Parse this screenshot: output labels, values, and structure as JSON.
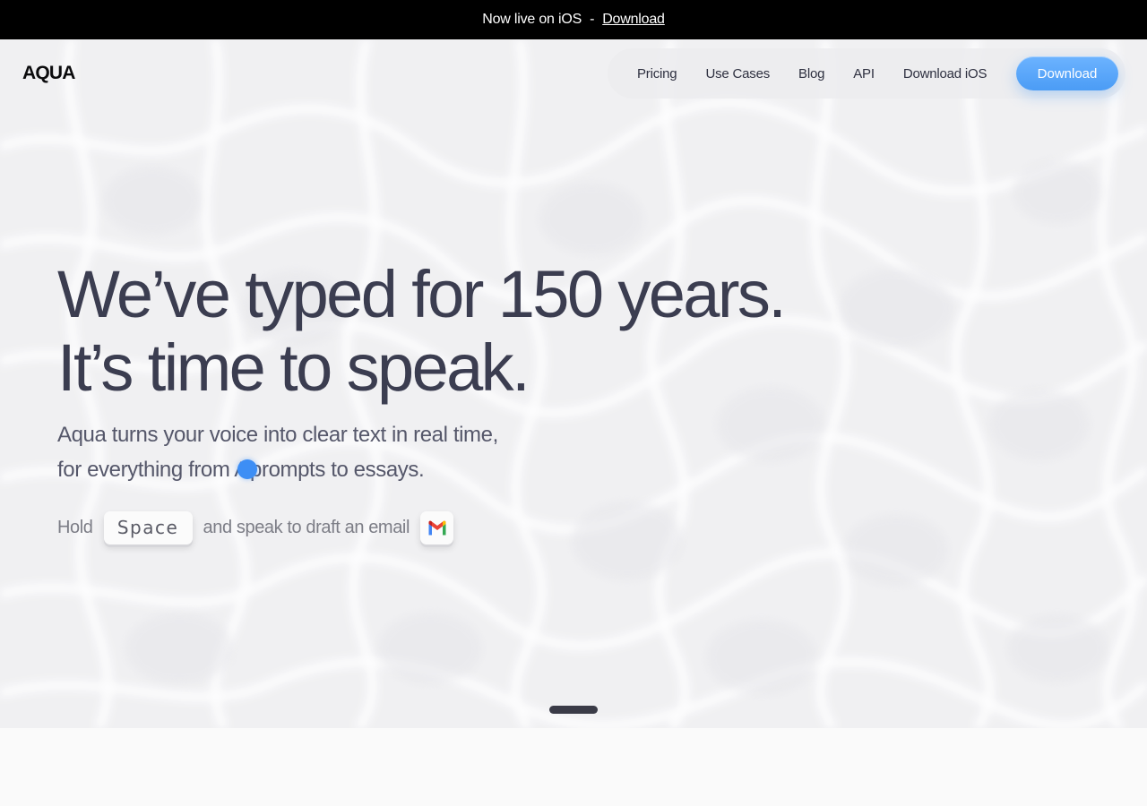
{
  "announcement": {
    "text": "Now live on iOS",
    "separator": "-",
    "link": "Download"
  },
  "brand": {
    "logo": "AQUA"
  },
  "nav": {
    "items": [
      {
        "label": "Pricing"
      },
      {
        "label": "Use Cases"
      },
      {
        "label": "Blog"
      },
      {
        "label": "API"
      },
      {
        "label": "Download iOS"
      }
    ],
    "cta": "Download"
  },
  "hero": {
    "headline_line1": "We’ve typed for 150 years.",
    "headline_line2": "It’s time to speak.",
    "subtitle_line1": "Aqua turns your voice into clear text in real time,",
    "subtitle_line2_before": "for everything from A",
    "subtitle_line2_after": "prompts to essays.",
    "hold_prefix": "Hold",
    "key_label": "Space",
    "hold_suffix": "and speak to draft an email"
  },
  "icons": {
    "app_icon": "gmail-icon",
    "cursor": "voice-cursor-dot"
  },
  "colors": {
    "accent": "#4b9cf5",
    "headline": "#3b3d50",
    "announce_bg": "#000000"
  }
}
